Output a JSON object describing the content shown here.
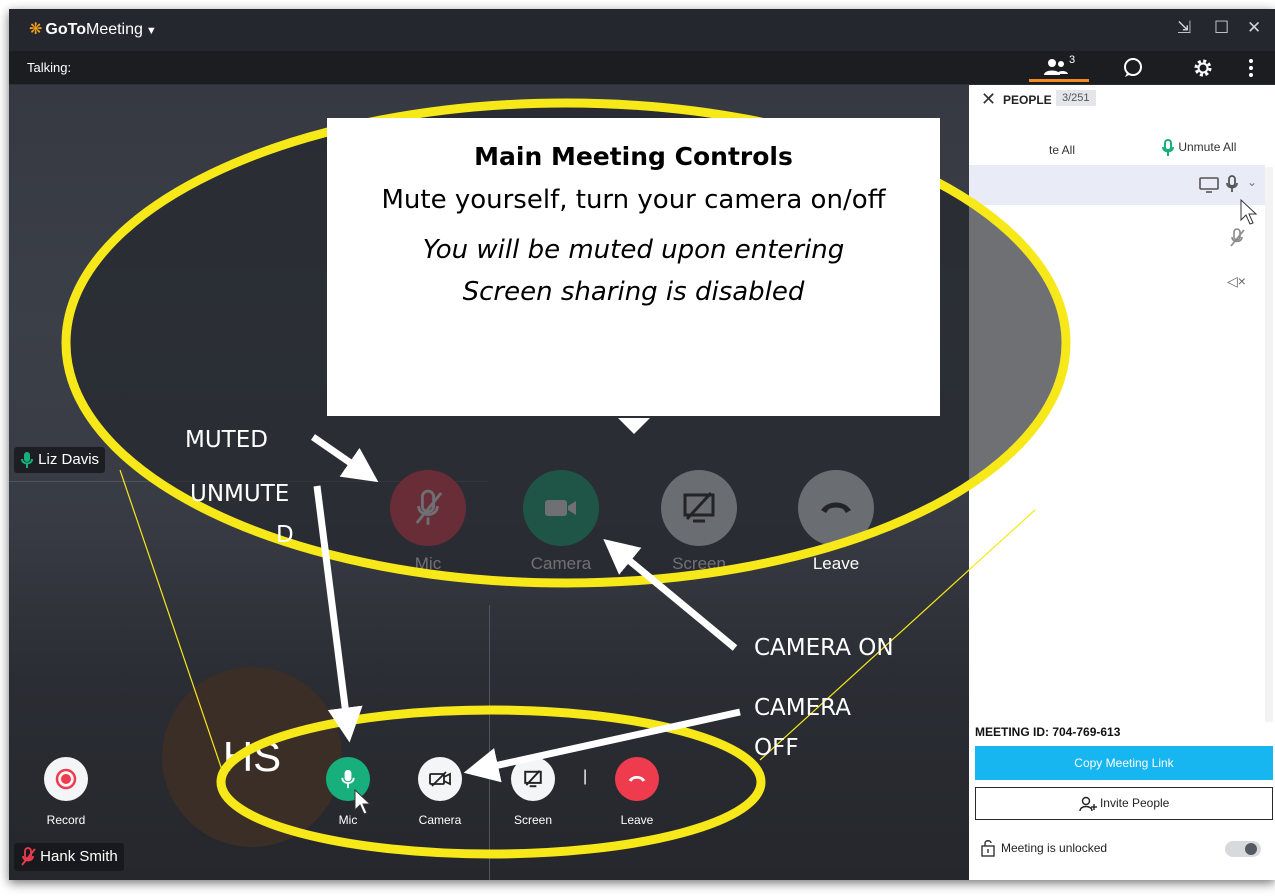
{
  "app": {
    "title_brand": "GoTo",
    "title_rest": "Meeting",
    "window_controls": [
      "⇲",
      "☐",
      "✕"
    ]
  },
  "toolbar": {
    "talking_label": "Talking:",
    "people_count": "3"
  },
  "tiles": {
    "liz_name": "Liz Davis",
    "hank_name": "Hank Smith",
    "hank_initials": "HS"
  },
  "main_controls": {
    "mic": "Mic",
    "camera": "Camera",
    "screen": "Screen",
    "leave": "Leave"
  },
  "bottom_controls": {
    "record": "Record",
    "mic": "Mic",
    "camera": "Camera",
    "screen": "Screen",
    "separator": "|",
    "leave": "Leave"
  },
  "people_panel": {
    "title": "PEOPLE",
    "count": "3/251",
    "mute_all_partial": "te All",
    "unmute_all": "Unmute All",
    "meeting_id": "MEETING ID: 704-769-613",
    "copy_link": "Copy Meeting Link",
    "invite": "Invite People",
    "lock_status": "Meeting is unlocked"
  },
  "callout": {
    "title": "Main Meeting Controls",
    "line1": "Mute yourself, turn your camera on/off",
    "line2": "You will be muted upon entering",
    "line3": "Screen sharing is disabled"
  },
  "annotations": {
    "muted": "MUTED",
    "unmuted_a": "UNMUTE",
    "unmuted_b": "D",
    "camera_on": "CAMERA ON",
    "camera_off_a": "CAMERA",
    "camera_off_b": "OFF"
  },
  "colors": {
    "mic_muted": "#ef3b4e",
    "mic_unmuted": "#17b07d",
    "camera_on": "#17b07d",
    "leave": "#ef3b4e",
    "highlight": "#f7e81a",
    "copy_link": "#17b6f0",
    "brand_accent": "#f7a21b"
  }
}
